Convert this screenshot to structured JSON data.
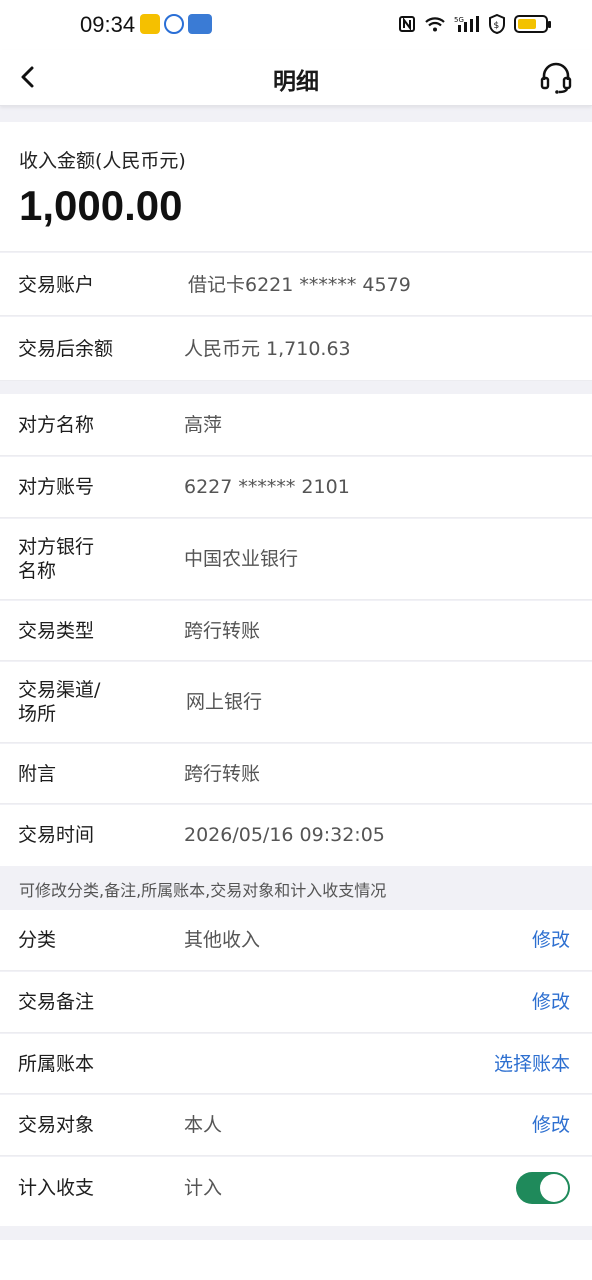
{
  "status_bar": {
    "time": "09:34"
  },
  "header": {
    "title": "明细"
  },
  "amount": {
    "label": "收入金额(人民币元)",
    "value": "1,000.00"
  },
  "account_rows": [
    {
      "key": "交易账户",
      "value": "借记卡6221 ****** 4579"
    },
    {
      "key": "交易后余额",
      "value": "人民币元 1,710.63"
    }
  ],
  "detail_rows": [
    {
      "key": "对方名称",
      "value": "高萍"
    },
    {
      "key": "对方账号",
      "value": "6227 ****** 2101"
    },
    {
      "key_line1": "对方银行",
      "key_line2": "名称",
      "value": "中国农业银行"
    },
    {
      "key": "交易类型",
      "value": "跨行转账"
    },
    {
      "key_line1": "交易渠道/",
      "key_line2": "场所",
      "value": "网上银行"
    },
    {
      "key": "附言",
      "value": "跨行转账"
    },
    {
      "key": "交易时间",
      "value": "2026/05/16 09:32:05"
    }
  ],
  "edit_note": "可修改分类,备注,所属账本,交易对象和计入收支情况",
  "edit_rows": [
    {
      "key": "分类",
      "value": "其他收入",
      "action": "修改"
    },
    {
      "key": "交易备注",
      "value": "",
      "action": "修改"
    },
    {
      "key": "所属账本",
      "value": "",
      "action": "选择账本"
    },
    {
      "key": "交易对象",
      "value": "本人",
      "action": "修改"
    },
    {
      "key": "计入收支",
      "value": "计入",
      "toggle_on": true
    }
  ],
  "colors": {
    "accent": "#2d6fd0",
    "toggle": "#1f8a5b",
    "background": "#f1f1f6"
  }
}
